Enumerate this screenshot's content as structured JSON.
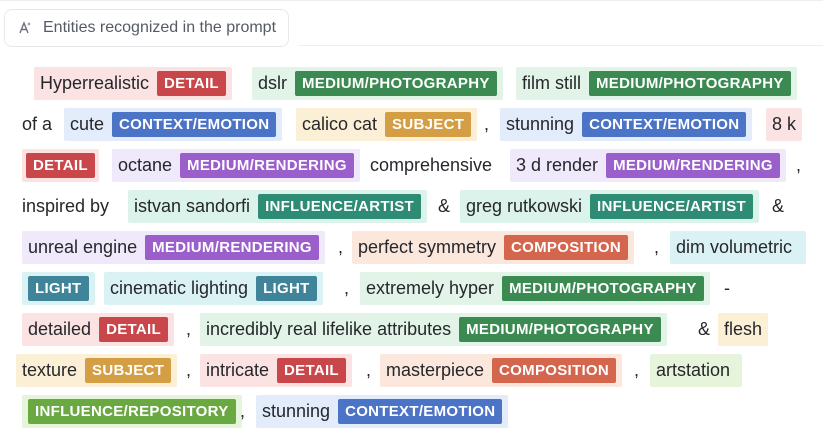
{
  "header": {
    "title": "Entities recognized in the prompt",
    "icon": "sparkle-text-icon"
  },
  "tags": {
    "detail": "DETAIL",
    "photo": "MEDIUM/PHOTOGRAPHY",
    "emotion": "CONTEXT/EMOTION",
    "subject": "SUBJECT",
    "render": "MEDIUM/RENDERING",
    "artist": "INFLUENCE/ARTIST",
    "composition": "COMPOSITION",
    "light": "LIGHT",
    "repository": "INFLUENCE/REPOSITORY"
  },
  "colors": {
    "detail": "#c9474b",
    "photo": "#3a8a52",
    "emotion": "#4b74c6",
    "subject": "#d49e45",
    "render": "#9a5fcb",
    "artist": "#2f8c74",
    "composition": "#d4664e",
    "light": "#3f8499",
    "repository": "#6aa842"
  },
  "entities": {
    "hyperrealistic": "Hyperrealistic",
    "dslr": "dslr",
    "film_still": "film still",
    "of_a": "of a",
    "cute": "cute",
    "calico_cat": "calico cat",
    "comma": ",",
    "stunning": "stunning",
    "eight_k": "8 k",
    "octane": "octane",
    "comprehensive": "comprehensive",
    "three_d_render": "3 d render",
    "inspired_by": "inspired by",
    "istvan_sandorfi": "istvan sandorfi",
    "amp": "&",
    "greg_rutkowski": "greg rutkowski",
    "unreal_engine": "unreal engine",
    "perfect_symmetry": "perfect symmetry",
    "dim_volumetric": "dim volumetric",
    "cinematic_lighting": "cinematic lighting",
    "extremely_hyper": "extremely hyper",
    "dash": "-",
    "detailed": "detailed",
    "incredibly_real": "incredibly real lifelike attributes",
    "flesh": "flesh",
    "texture": "texture",
    "intricate": "intricate",
    "masterpiece": "masterpiece",
    "artstation": "artstation",
    "stunning2": "stunning"
  }
}
